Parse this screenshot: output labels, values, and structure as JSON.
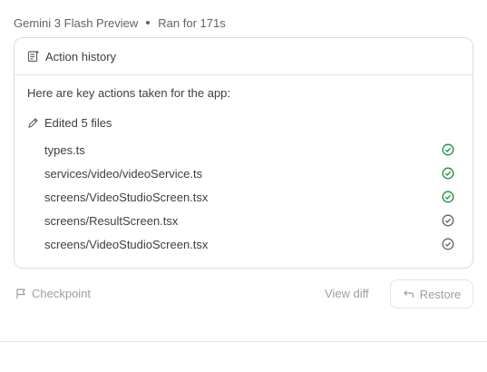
{
  "meta": {
    "model": "Gemini 3 Flash Preview",
    "run_time": "Ran for 171s"
  },
  "card": {
    "header_title": "Action history",
    "header_icon": "action-history-icon",
    "intro": "Here are key actions taken for the app:",
    "edited_label": "Edited 5 files",
    "edited_icon": "pencil-icon",
    "files": [
      {
        "name": "types.ts",
        "status": "complete"
      },
      {
        "name": "services/video/videoService.ts",
        "status": "complete"
      },
      {
        "name": "screens/VideoStudioScreen.tsx",
        "status": "complete"
      },
      {
        "name": "screens/ResultScreen.tsx",
        "status": "pending"
      },
      {
        "name": "screens/VideoStudioScreen.tsx",
        "status": "pending"
      }
    ]
  },
  "footer": {
    "checkpoint_label": "Checkpoint",
    "checkpoint_icon": "flag-icon",
    "view_diff_label": "View diff",
    "restore_label": "Restore",
    "restore_icon": "restore-arrow-icon"
  },
  "colors": {
    "complete": "#1e8e3e",
    "pending": "#5f6368",
    "muted": "#9aa0a6"
  }
}
